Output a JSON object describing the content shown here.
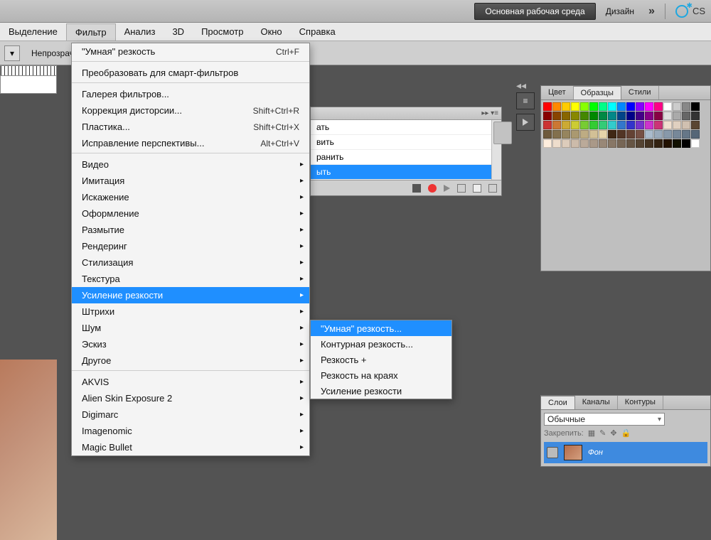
{
  "top": {
    "workspace_btn": "Основная рабочая среда",
    "design_btn": "Дизайн",
    "expand": "»",
    "cs_label": "CS"
  },
  "menu": {
    "selection": "Выделение",
    "filter": "Фильтр",
    "analysis": "Анализ",
    "three_d": "3D",
    "view": "Просмотр",
    "window": "Окно",
    "help": "Справка"
  },
  "options_bar": {
    "opacity_label": "Непрозрач"
  },
  "filter_menu": {
    "smart_sharpen": "\"Умная\" резкость",
    "smart_sharpen_shortcut": "Ctrl+F",
    "convert_smart": "Преобразовать для смарт-фильтров",
    "filter_gallery": "Галерея фильтров...",
    "lens_correction": "Коррекция дисторсии...",
    "lens_correction_shortcut": "Shift+Ctrl+R",
    "liquify": "Пластика...",
    "liquify_shortcut": "Shift+Ctrl+X",
    "vanishing_point": "Исправление перспективы...",
    "vanishing_point_shortcut": "Alt+Ctrl+V",
    "video": "Видео",
    "artistic": "Имитация",
    "distort": "Искажение",
    "render": "Оформление",
    "blur": "Размытие",
    "rendering": "Рендеринг",
    "stylize": "Стилизация",
    "texture": "Текстура",
    "sharpen": "Усиление резкости",
    "strokes": "Штрихи",
    "noise": "Шум",
    "sketch": "Эскиз",
    "other": "Другое",
    "akvis": "AKVIS",
    "alien_skin": "Alien Skin Exposure 2",
    "digimarc": "Digimarc",
    "imagenomic": "Imagenomic",
    "magic_bullet": "Magic Bullet"
  },
  "sharpen_submenu": {
    "smart_sharpen": "\"Умная\" резкость...",
    "unsharp_mask": "Контурная резкость...",
    "sharpen_plus": "Резкость +",
    "sharpen_edges": "Резкость на краях",
    "sharpen": "Усиление резкости"
  },
  "mid_panel": {
    "item1": "ать",
    "item2": "вить",
    "item3": "ранить",
    "item4": "ыть"
  },
  "swatches": {
    "tab_color": "Цвет",
    "tab_swatches": "Образцы",
    "tab_styles": "Стили",
    "colors": [
      "#ff0000",
      "#ff8800",
      "#ffcc00",
      "#ffff00",
      "#88ff00",
      "#00ff00",
      "#00ff88",
      "#00ffff",
      "#0088ff",
      "#0000ff",
      "#8800ff",
      "#ff00ff",
      "#ff0088",
      "#ffffff",
      "#cccccc",
      "#888888",
      "#000000",
      "#880000",
      "#884400",
      "#886600",
      "#888800",
      "#448800",
      "#008800",
      "#008844",
      "#008888",
      "#004488",
      "#000088",
      "#440088",
      "#880088",
      "#880044",
      "#dddddd",
      "#aaaaaa",
      "#666666",
      "#333333",
      "#cc3333",
      "#cc7733",
      "#ccaa33",
      "#cccc33",
      "#77cc33",
      "#33cc33",
      "#33cc77",
      "#33cccc",
      "#3377cc",
      "#3333cc",
      "#7733cc",
      "#cc33cc",
      "#cc3377",
      "#f0e0d0",
      "#e0d0c0",
      "#d0c0b0",
      "#5a4632",
      "#6e5a3c",
      "#82704d",
      "#96855e",
      "#aa9970",
      "#beac83",
      "#d2c096",
      "#e6d4a9",
      "#402815",
      "#523525",
      "#644234",
      "#765044",
      "#aabbcc",
      "#99aabb",
      "#8899aa",
      "#778899",
      "#667788",
      "#556677",
      "#ffeedd",
      "#eeddcc",
      "#ddccbb",
      "#ccbbaa",
      "#bbaa99",
      "#aa9988",
      "#998877",
      "#887766",
      "#776655",
      "#665544",
      "#554433",
      "#443322",
      "#332211",
      "#221100",
      "#111000",
      "#000000",
      "#ffffff"
    ]
  },
  "layers": {
    "tab_layers": "Слои",
    "tab_channels": "Каналы",
    "tab_paths": "Контуры",
    "blend_mode": "Обычные",
    "lock_label": "Закрепить:",
    "layer_name": "Фон"
  },
  "icons": {
    "stop": "stop-icon",
    "record": "record-icon",
    "play": "play-icon",
    "folder": "folder-icon",
    "new": "new-icon",
    "trash": "trash-icon",
    "lock_pixels": "lock-pixels-icon",
    "lock_brush": "lock-brush-icon",
    "lock_move": "lock-move-icon",
    "lock_all": "lock-all-icon",
    "eye": "eye-icon"
  }
}
